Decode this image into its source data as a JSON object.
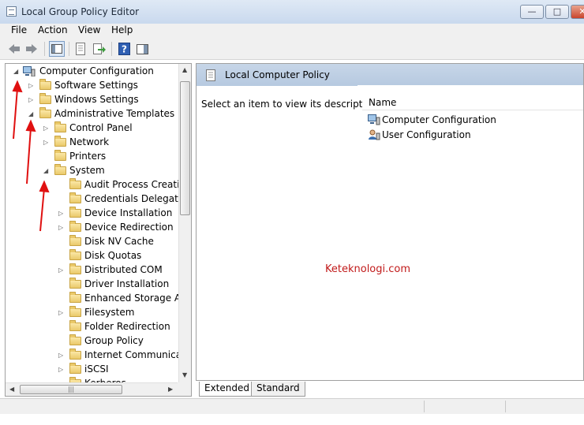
{
  "window": {
    "title": "Local Group Policy Editor",
    "buttons": {
      "minimize": "—",
      "maximize": "□",
      "close": "✕"
    }
  },
  "menu": [
    "File",
    "Action",
    "View",
    "Help"
  ],
  "toolbar": {
    "icons": [
      "back-icon",
      "forward-icon",
      "show-hide-tree-icon",
      "properties-icon",
      "export-list-icon",
      "help-icon",
      "show-hide-action-pane-icon"
    ]
  },
  "tree": {
    "rows": [
      {
        "label": "Computer Configuration",
        "expander": "expanded",
        "icon": "computer-icon"
      },
      {
        "label": "Software Settings",
        "expander": "collapsed",
        "icon": "folder-icon"
      },
      {
        "label": "Windows Settings",
        "expander": "collapsed",
        "icon": "folder-icon"
      },
      {
        "label": "Administrative Templates",
        "expander": "expanded",
        "icon": "folder-icon"
      },
      {
        "label": "Control Panel",
        "expander": "collapsed",
        "icon": "folder-icon"
      },
      {
        "label": "Network",
        "expander": "collapsed",
        "icon": "folder-icon"
      },
      {
        "label": "Printers",
        "expander": "none",
        "icon": "folder-icon"
      },
      {
        "label": "System",
        "expander": "expanded",
        "icon": "folder-icon"
      },
      {
        "label": "Audit Process Creation",
        "expander": "none",
        "icon": "folder-icon"
      },
      {
        "label": "Credentials Delegation",
        "expander": "none",
        "icon": "folder-icon"
      },
      {
        "label": "Device Installation",
        "expander": "collapsed",
        "icon": "folder-icon"
      },
      {
        "label": "Device Redirection",
        "expander": "collapsed",
        "icon": "folder-icon"
      },
      {
        "label": "Disk NV Cache",
        "expander": "none",
        "icon": "folder-icon"
      },
      {
        "label": "Disk Quotas",
        "expander": "none",
        "icon": "folder-icon"
      },
      {
        "label": "Distributed COM",
        "expander": "collapsed",
        "icon": "folder-icon"
      },
      {
        "label": "Driver Installation",
        "expander": "none",
        "icon": "folder-icon"
      },
      {
        "label": "Enhanced Storage Access",
        "expander": "none",
        "icon": "folder-icon"
      },
      {
        "label": "Filesystem",
        "expander": "collapsed",
        "icon": "folder-icon"
      },
      {
        "label": "Folder Redirection",
        "expander": "none",
        "icon": "folder-icon"
      },
      {
        "label": "Group Policy",
        "expander": "none",
        "icon": "folder-icon"
      },
      {
        "label": "Internet Communication",
        "expander": "collapsed",
        "icon": "folder-icon"
      },
      {
        "label": "iSCSI",
        "expander": "collapsed",
        "icon": "folder-icon"
      },
      {
        "label": "Kerberos",
        "expander": "none",
        "icon": "folder-icon"
      }
    ]
  },
  "right_pane": {
    "title": "Local Computer Policy",
    "description": "Select an item to view its description.",
    "column_header": "Name",
    "items": [
      {
        "label": "Computer Configuration",
        "icon": "computer-icon"
      },
      {
        "label": "User Configuration",
        "icon": "user-icon"
      }
    ],
    "watermark": "Keteknologi.com"
  },
  "tabs": [
    "Extended",
    "Standard"
  ],
  "annotation_color": "#e01010"
}
